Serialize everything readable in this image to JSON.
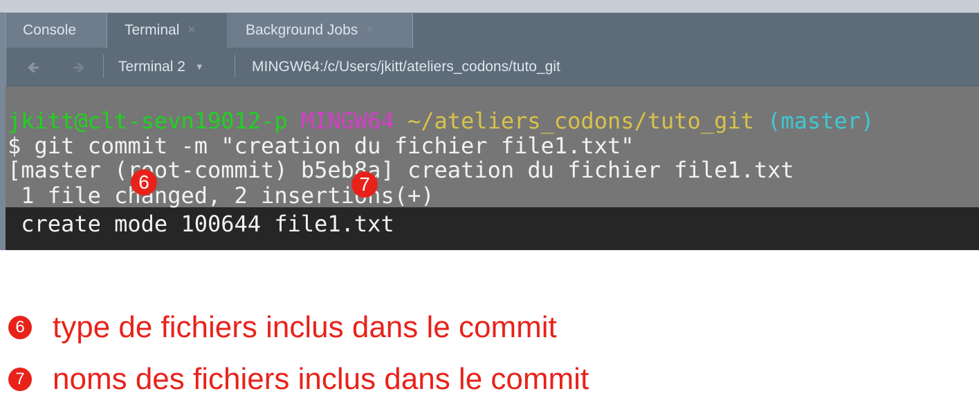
{
  "tabs": [
    {
      "label": "Console",
      "closable": false
    },
    {
      "label": "Terminal",
      "closable": true,
      "active": true
    },
    {
      "label": "Background Jobs",
      "closable": true
    }
  ],
  "tab_close_glyph": "×",
  "toolbar": {
    "back_icon": "arrow-left-icon",
    "forward_icon": "arrow-right-icon",
    "terminal_selector": "Terminal 2",
    "terminal_path": "MINGW64:/c/Users/jkitt/ateliers_codons/tuto_git"
  },
  "terminal": {
    "prompt": {
      "user_host": "jkitt@clt-sevn19012-p",
      "env": "MINGW64",
      "path": "~/ateliers_codons/tuto_git",
      "branch": "(master)"
    },
    "lines": [
      "$ git commit -m \"creation du fichier file1.txt\"",
      "[master (root-commit) b5eb8a] creation du fichier file1.txt",
      " 1 file changed, 2 insertions(+)",
      " create mode 100644 file1.txt"
    ]
  },
  "annotations": [
    {
      "number": "6",
      "text": "type de fichiers inclus dans le commit"
    },
    {
      "number": "7",
      "text": "noms des fichiers inclus dans le commit"
    }
  ],
  "colors": {
    "user_host": "#1fd21f",
    "env": "#d43fc8",
    "path": "#d9c24a",
    "branch": "#3fc8d4",
    "annotation": "#e8221a"
  }
}
